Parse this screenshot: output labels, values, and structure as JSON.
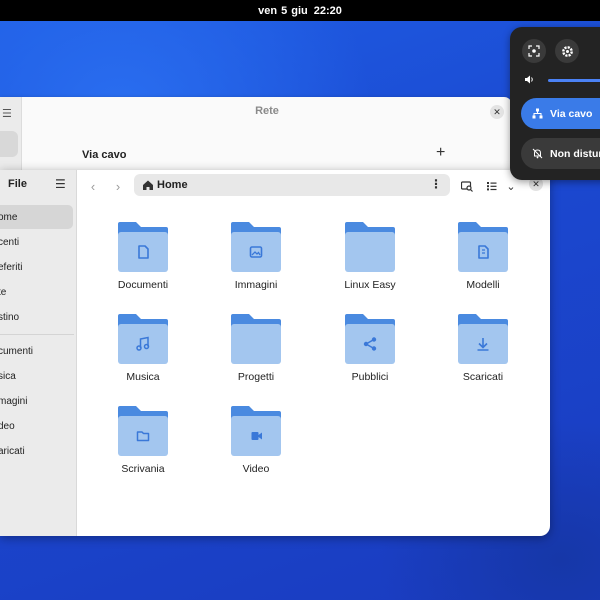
{
  "topbar": {
    "date": "ven 5 giu",
    "time": "22:20"
  },
  "network_window": {
    "title": "Rete",
    "section_label": "Via cavo",
    "add_label": "+"
  },
  "files": {
    "sidebar_title": "File",
    "sidebar_items": [
      {
        "label": "ome",
        "icon": "home-icon",
        "active": true
      },
      {
        "label": "centi",
        "icon": "recent-icon"
      },
      {
        "label": "eferiti",
        "icon": "star-icon"
      },
      {
        "label": "te",
        "icon": "network-icon"
      },
      {
        "label": "stino",
        "icon": "trash-icon"
      },
      {
        "label": "cumenti",
        "icon": "document-icon"
      },
      {
        "label": "sica",
        "icon": "music-icon"
      },
      {
        "label": "magini",
        "icon": "image-icon"
      },
      {
        "label": "deo",
        "icon": "video-icon"
      },
      {
        "label": "aricati",
        "icon": "download-icon"
      }
    ],
    "path_label": "Home",
    "folders": [
      {
        "name": "Documenti",
        "emblem": "document"
      },
      {
        "name": "Immagini",
        "emblem": "image"
      },
      {
        "name": "Linux Easy",
        "emblem": "none"
      },
      {
        "name": "Modelli",
        "emblem": "template"
      },
      {
        "name": "Musica",
        "emblem": "music"
      },
      {
        "name": "Progetti",
        "emblem": "none"
      },
      {
        "name": "Pubblici",
        "emblem": "share"
      },
      {
        "name": "Scaricati",
        "emblem": "download"
      },
      {
        "name": "Scrivania",
        "emblem": "desktop"
      },
      {
        "name": "Video",
        "emblem": "video"
      }
    ]
  },
  "quick_settings": {
    "volume_level": 1.0,
    "wired_label": "Via cavo",
    "dnd_label": "Non disturb"
  },
  "colors": {
    "folder_light": "#a3c6ef",
    "folder_dark": "#4a8ae0",
    "accent": "#3a7be8"
  }
}
